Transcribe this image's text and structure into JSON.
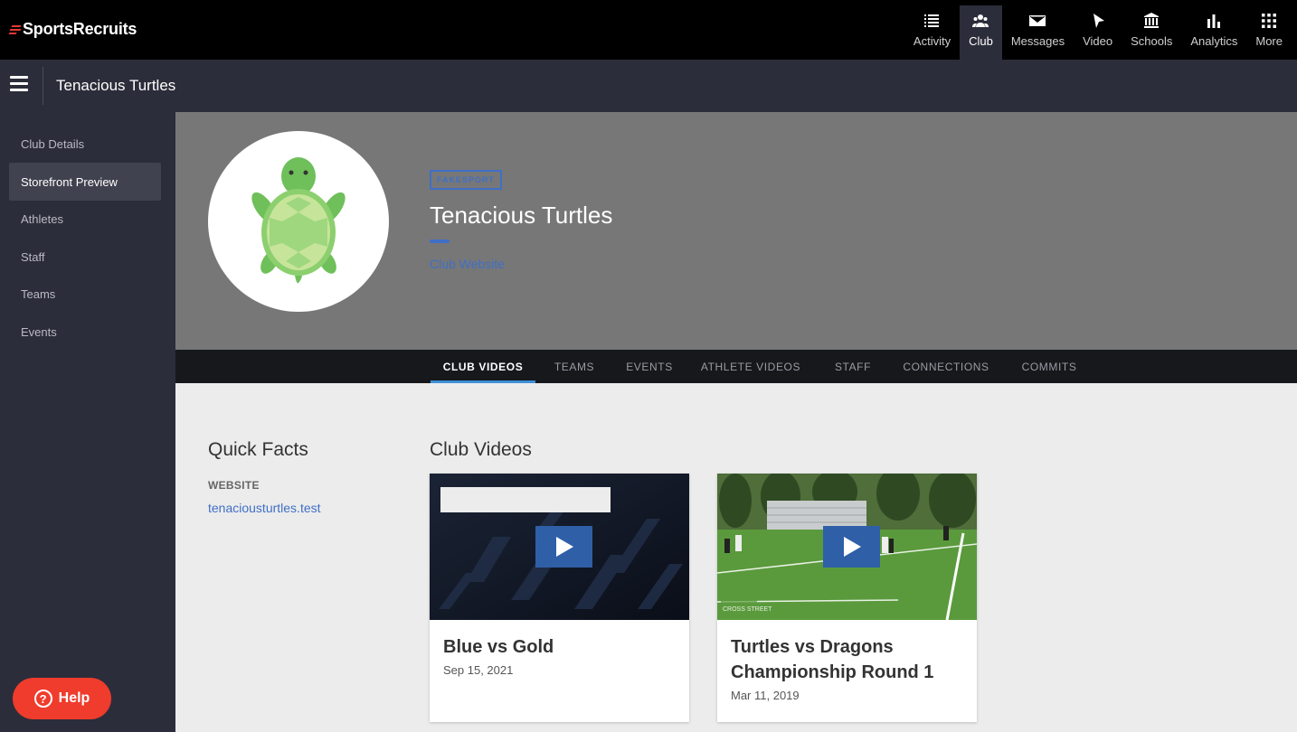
{
  "brand": {
    "name": "SportsRecruits"
  },
  "topnav": {
    "items": [
      {
        "label": "Activity",
        "icon": "list-icon"
      },
      {
        "label": "Club",
        "icon": "people-icon",
        "active": true
      },
      {
        "label": "Messages",
        "icon": "envelope-icon"
      },
      {
        "label": "Video",
        "icon": "play-arrow-icon"
      },
      {
        "label": "Schools",
        "icon": "bank-icon"
      },
      {
        "label": "Analytics",
        "icon": "bar-chart-icon"
      },
      {
        "label": "More",
        "icon": "grid-dots-icon"
      }
    ]
  },
  "subbar": {
    "title": "Tenacious Turtles"
  },
  "sidebar": {
    "items": [
      {
        "label": "Club Details"
      },
      {
        "label": "Storefront Preview",
        "active": true
      },
      {
        "label": "Athletes"
      },
      {
        "label": "Staff"
      },
      {
        "label": "Teams"
      },
      {
        "label": "Events"
      }
    ],
    "help_label": "Help"
  },
  "hero": {
    "sport_badge": "FAKESPORT",
    "club_name": "Tenacious Turtles",
    "website_link": "Club Website"
  },
  "tabs": [
    {
      "label": "CLUB VIDEOS",
      "active": true
    },
    {
      "label": "TEAMS"
    },
    {
      "label": "EVENTS"
    },
    {
      "label": "ATHLETE VIDEOS"
    },
    {
      "label": "STAFF"
    },
    {
      "label": "CONNECTIONS"
    },
    {
      "label": "COMMITS"
    }
  ],
  "quick_facts": {
    "title": "Quick Facts",
    "website_label": "WEBSITE",
    "website_value": "tenaciousturtles.test"
  },
  "club_videos": {
    "title": "Club Videos",
    "videos": [
      {
        "title": "Blue vs Gold",
        "date": "Sep 15, 2021"
      },
      {
        "title": "Turtles vs Dragons Championship Round 1",
        "date": "Mar 11, 2019"
      }
    ]
  },
  "colors": {
    "accent": "#3f6fc6",
    "help_button": "#ef3c2d",
    "nav_bg": "#000000",
    "sidebar_bg": "#2c2d3a"
  }
}
